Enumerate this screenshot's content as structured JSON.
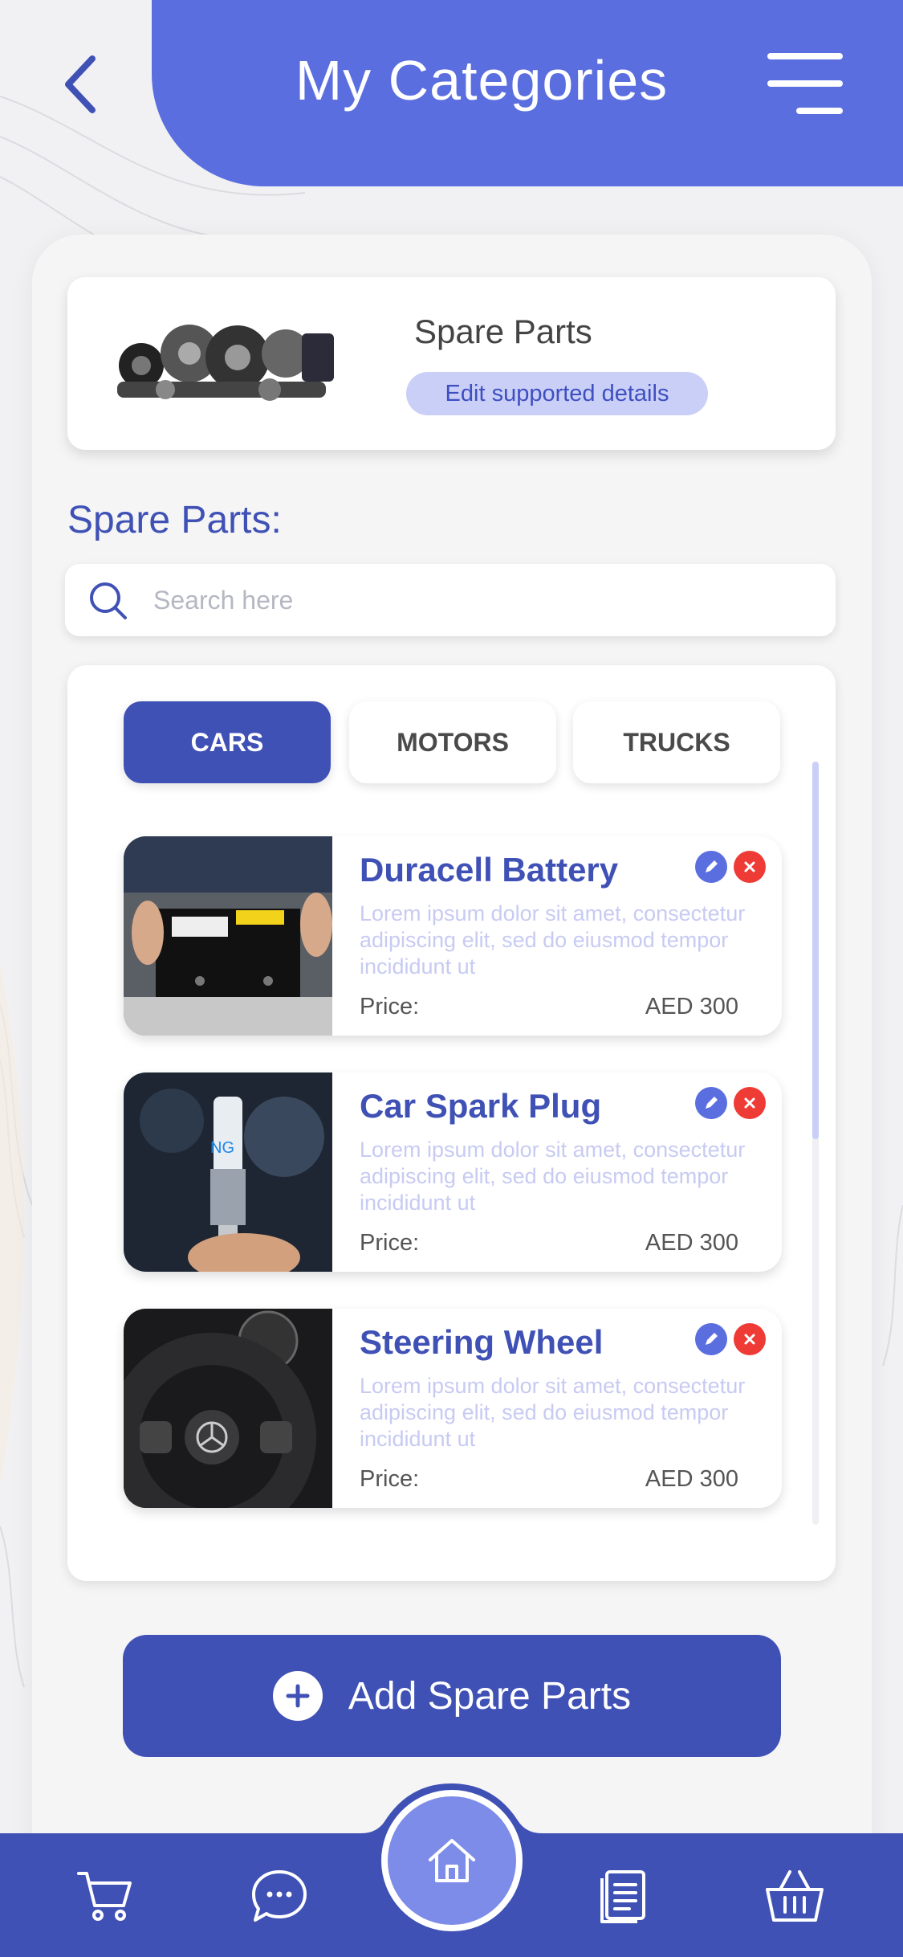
{
  "header": {
    "title": "My Categories"
  },
  "category": {
    "name": "Spare Parts",
    "edit_label": "Edit supported details"
  },
  "section": {
    "heading": "Spare Parts:"
  },
  "search": {
    "placeholder": "Search here"
  },
  "tabs": [
    {
      "label": "CARS",
      "active": true
    },
    {
      "label": "MOTORS",
      "active": false
    },
    {
      "label": "TRUCKS",
      "active": false
    }
  ],
  "products": [
    {
      "name": "Duracell Battery",
      "description": "Lorem ipsum dolor sit amet, consectetur adipiscing elit, sed do eiusmod tempor incididunt ut",
      "price_label": "Price:",
      "price": "AED 300",
      "image": "car-battery-photo"
    },
    {
      "name": "Car Spark Plug",
      "description": "Lorem ipsum dolor sit amet, consectetur adipiscing elit, sed do eiusmod tempor incididunt ut",
      "price_label": "Price:",
      "price": "AED 300",
      "image": "spark-plug-photo"
    },
    {
      "name": "Steering Wheel",
      "description": "Lorem ipsum dolor sit amet, consectetur adipiscing elit, sed do eiusmod tempor incididunt ut",
      "price_label": "Price:",
      "price": "AED 300",
      "image": "steering-wheel-photo"
    }
  ],
  "add_button": {
    "label": "Add Spare Parts"
  },
  "bottom_nav": {
    "items": [
      "cart-icon",
      "chat-icon",
      "home-icon",
      "orders-icon",
      "basket-icon"
    ]
  },
  "colors": {
    "primary": "#3f51b5",
    "header": "#5a6ee0",
    "accent_light": "#c9cff7",
    "delete": "#ef3b36"
  }
}
